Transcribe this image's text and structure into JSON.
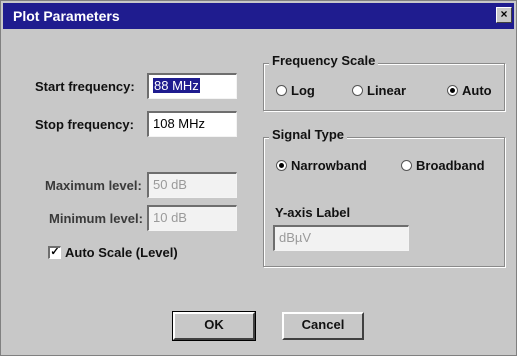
{
  "window": {
    "title": "Plot Parameters",
    "close_glyph": "×"
  },
  "frequency": {
    "start_label": "Start frequency:",
    "start_value": "88 MHz",
    "stop_label": "Stop frequency:",
    "stop_value": "108 MHz"
  },
  "level": {
    "maximum_label": "Maximum level:",
    "maximum_value": "50 dB",
    "minimum_label": "Minimum level:",
    "minimum_value": "10 dB",
    "auto_scale_label": "Auto Scale (Level)",
    "auto_scale_checked": true,
    "check_glyph": "✓"
  },
  "frequency_scale": {
    "title": "Frequency Scale",
    "options": [
      "Log",
      "Linear",
      "Auto"
    ],
    "selected": "Auto"
  },
  "signal_type": {
    "title": "Signal Type",
    "options": [
      "Narrowband",
      "Broadband"
    ],
    "selected": "Narrowband",
    "y_axis_label_title": "Y-axis Label",
    "y_axis_label_value": "dBµV"
  },
  "buttons": {
    "ok": "OK",
    "cancel": "Cancel"
  },
  "colors": {
    "title_bar": "#1f1c8f",
    "dialog_face": "#c8c8c8"
  }
}
